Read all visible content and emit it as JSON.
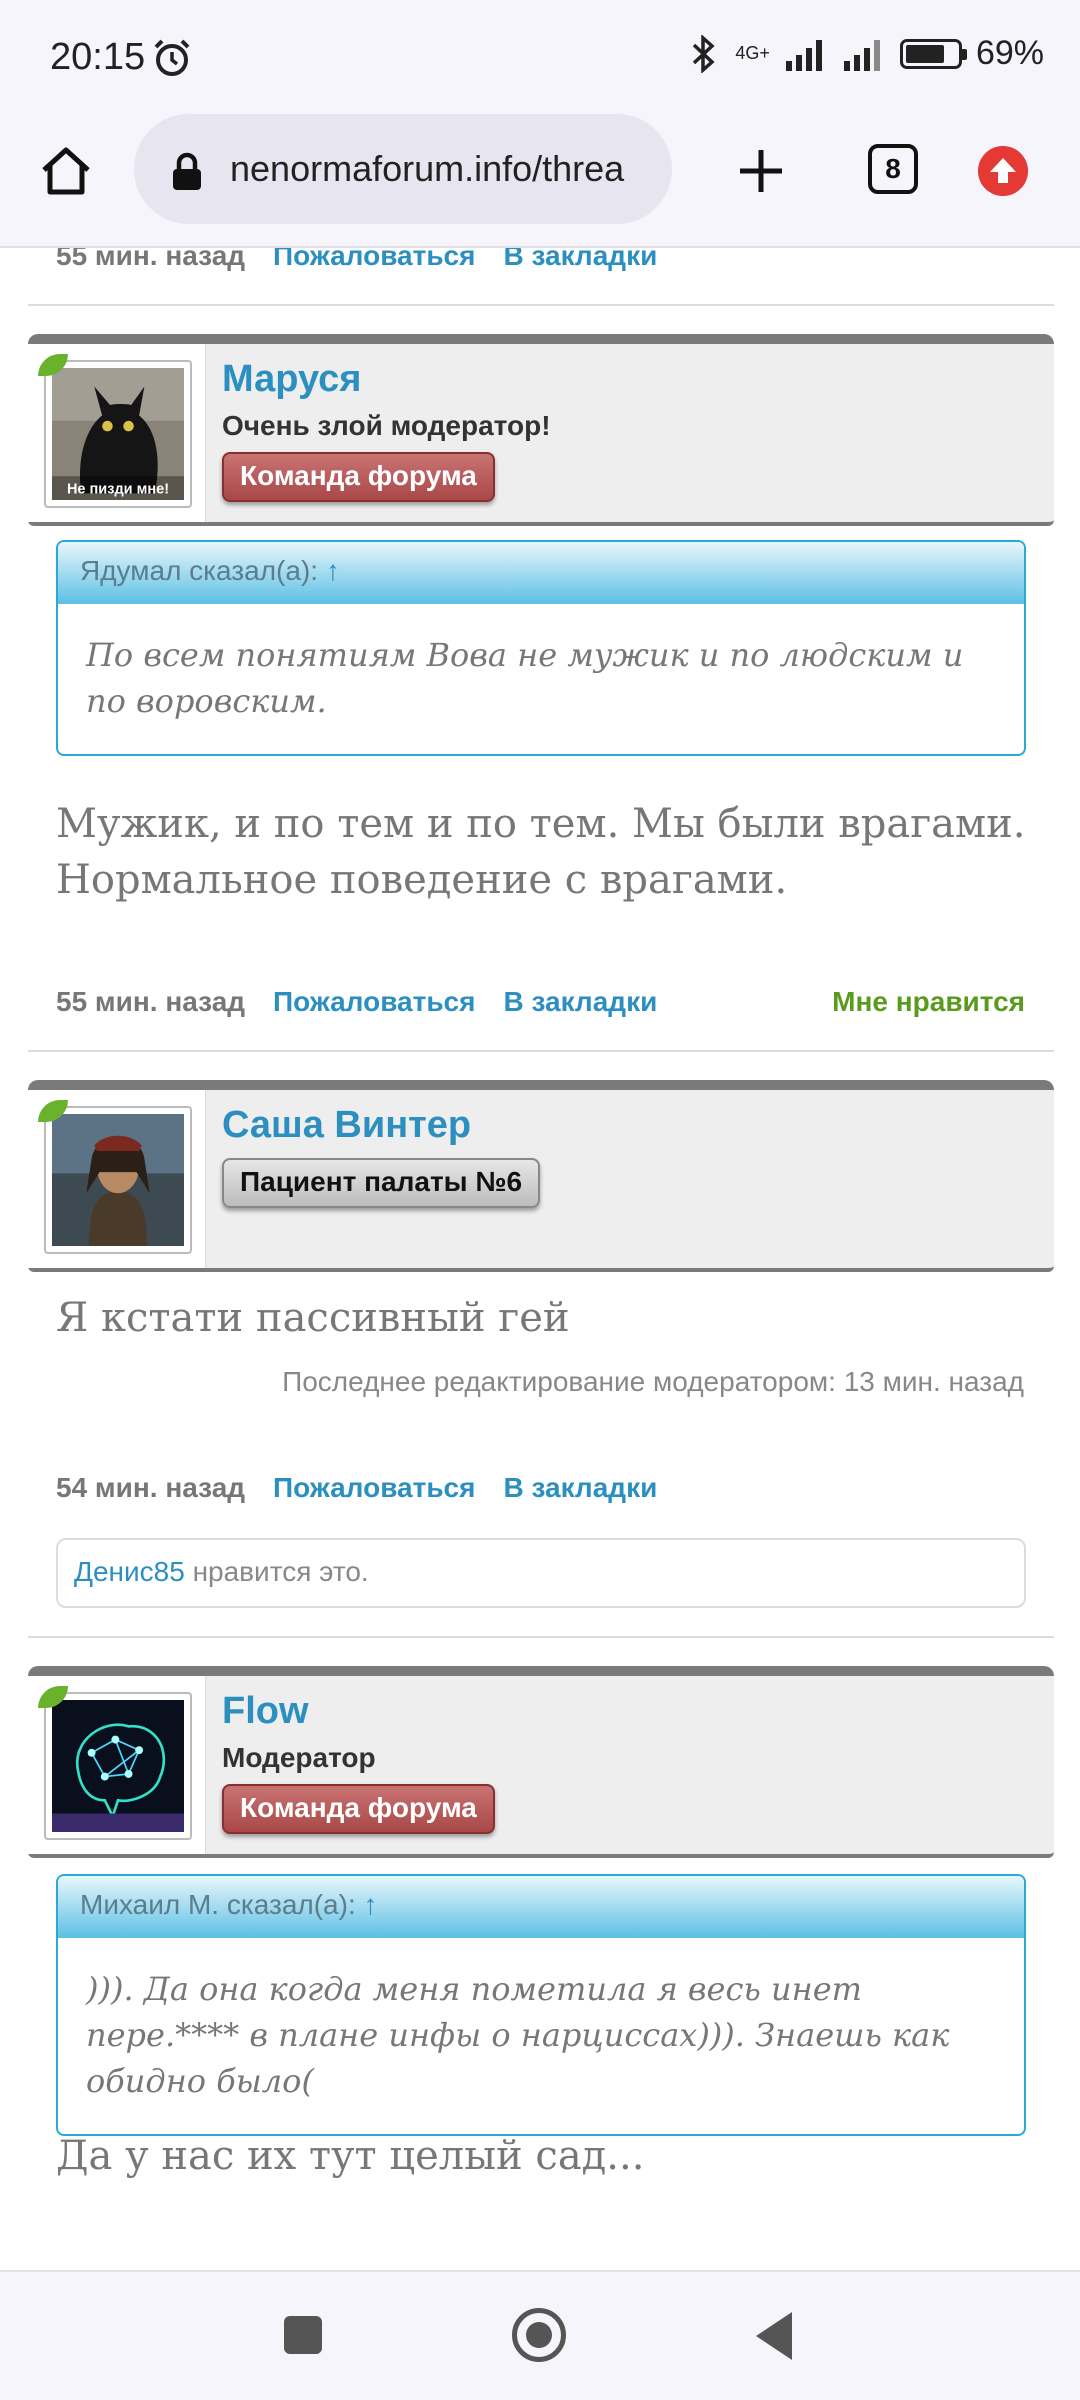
{
  "status_bar": {
    "time": "20:15",
    "network": "4G+",
    "battery": "69%"
  },
  "browser": {
    "url": "nenormaforum.info/threa",
    "tab_count": "8"
  },
  "top_meta": {
    "date": "55 мин. назад",
    "report": "Пожаловаться",
    "bookmark": "В закладки"
  },
  "posts": [
    {
      "username": "Маруся",
      "user_title": "Очень злой модератор!",
      "badge": "Команда форума",
      "avatar_caption": "Не пизди мне!",
      "quote_author": "Ядумал сказал(а):",
      "quote_arrow": "↑",
      "quote_text": "По всем понятиям Вова не мужик и по людским и по воровским.",
      "message": "Мужик, и по тем и по тем. Мы были врагами. Нормальное поведение с врагами.",
      "date": "55 мин. назад",
      "report": "Пожаловаться",
      "bookmark": "В закладки",
      "like": "Мне нравится"
    },
    {
      "username": "Саша Винтер",
      "badge": "Пациент палаты №6",
      "message": "Я кстати пассивный гей",
      "edit_note": "Последнее редактирование модератором: 13 мин. назад",
      "date": "54 мин. назад",
      "report": "Пожаловаться",
      "bookmark": "В закладки",
      "liked_by": "Денис85",
      "liked_suffix": " нравится это."
    },
    {
      "username": "Flow",
      "user_title": "Модератор",
      "badge": "Команда форума",
      "quote_author": "Михаил М. сказал(а):",
      "quote_arrow": "↑",
      "quote_text": "))). Да она когда меня пометила я весь инет пере.**** в плане инфы о нарциссах))). Знаешь как обидно было(",
      "message": "Да у нас их тут целый сад..."
    }
  ],
  "icons": {
    "home": "home-icon",
    "lock": "lock-icon",
    "plus": "plus-icon",
    "tabs": "tabs-icon",
    "update": "update-icon",
    "alarm": "alarm-icon"
  },
  "colors": {
    "link": "#2d8fc0",
    "like": "#5a9b1d",
    "badge_red": "#a94848",
    "quote_border": "#29a9d6"
  }
}
